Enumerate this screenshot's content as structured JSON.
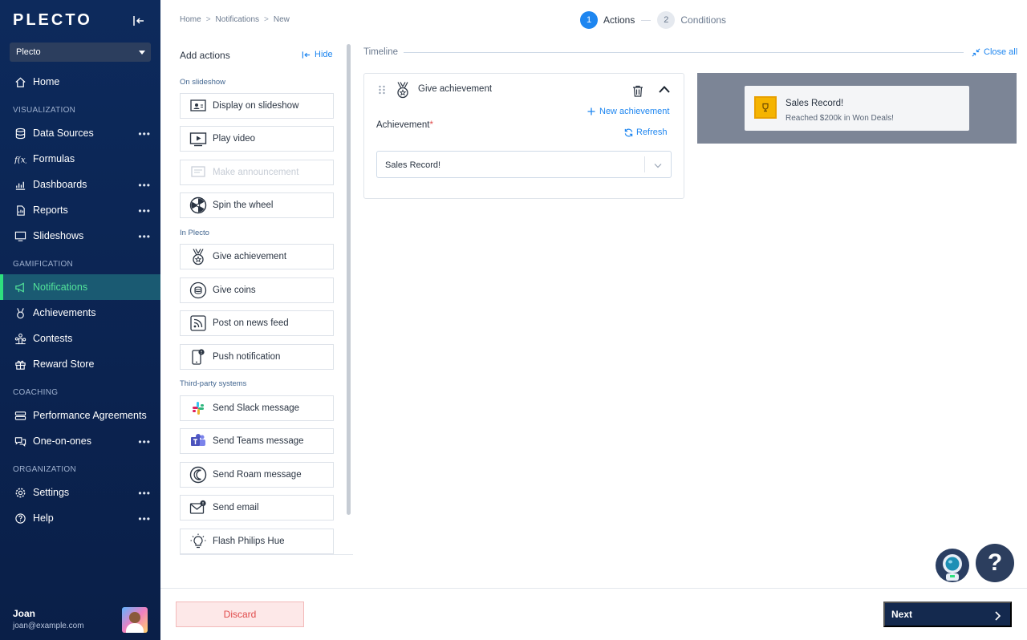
{
  "sidebar": {
    "logo": "PLECTO",
    "org_select": "Plecto",
    "sections": {
      "visualization": "VISUALIZATION",
      "gamification": "GAMIFICATION",
      "coaching": "COACHING",
      "organization": "ORGANIZATION"
    },
    "items": {
      "home": "Home",
      "data_sources": "Data Sources",
      "formulas": "Formulas",
      "dashboards": "Dashboards",
      "reports": "Reports",
      "slideshows": "Slideshows",
      "notifications": "Notifications",
      "achievements": "Achievements",
      "contests": "Contests",
      "reward_store": "Reward Store",
      "performance_agreements": "Performance Agreements",
      "one_on_ones": "One-on-ones",
      "settings": "Settings",
      "help": "Help"
    },
    "more": "•••",
    "user": {
      "name": "Joan",
      "email": "joan@example.com"
    }
  },
  "breadcrumb": {
    "home": "Home",
    "notifications": "Notifications",
    "current": "New",
    "sep": ">"
  },
  "steps": [
    {
      "number": "1",
      "label": "Actions"
    },
    {
      "number": "2",
      "label": "Conditions"
    }
  ],
  "actions_panel": {
    "title": "Add actions",
    "hide": "Hide",
    "groups": {
      "slideshow": "On slideshow",
      "plecto": "In Plecto",
      "third_party": "Third-party systems"
    },
    "buttons": {
      "display_on_slideshow": "Display on slideshow",
      "play_video": "Play video",
      "make_announcement": "Make announcement",
      "spin_the_wheel": "Spin the wheel",
      "give_achievement": "Give achievement",
      "give_coins": "Give coins",
      "post_on_news_feed": "Post on news feed",
      "push_notification": "Push notification",
      "send_slack": "Send Slack message",
      "send_teams": "Send Teams message",
      "send_roam": "Send Roam message",
      "send_email": "Send email",
      "flash_hue": "Flash Philips Hue"
    }
  },
  "timeline": {
    "label": "Timeline",
    "close_all": "Close all",
    "card": {
      "title": "Give achievement",
      "new_achievement": "New achievement",
      "achievement_label": "Achievement",
      "required_mark": "*",
      "refresh": "Refresh",
      "selected": "Sales Record!"
    }
  },
  "preview": {
    "title": "Sales Record!",
    "subtitle": "Reached $200k in Won Deals!"
  },
  "help_fab": "?",
  "footer": {
    "discard": "Discard",
    "next": "Next"
  },
  "colors": {
    "accent": "#1e86f0",
    "sidebar": "#0d2a5c",
    "active_green": "#2ee07e",
    "danger": "#e04a4a"
  }
}
